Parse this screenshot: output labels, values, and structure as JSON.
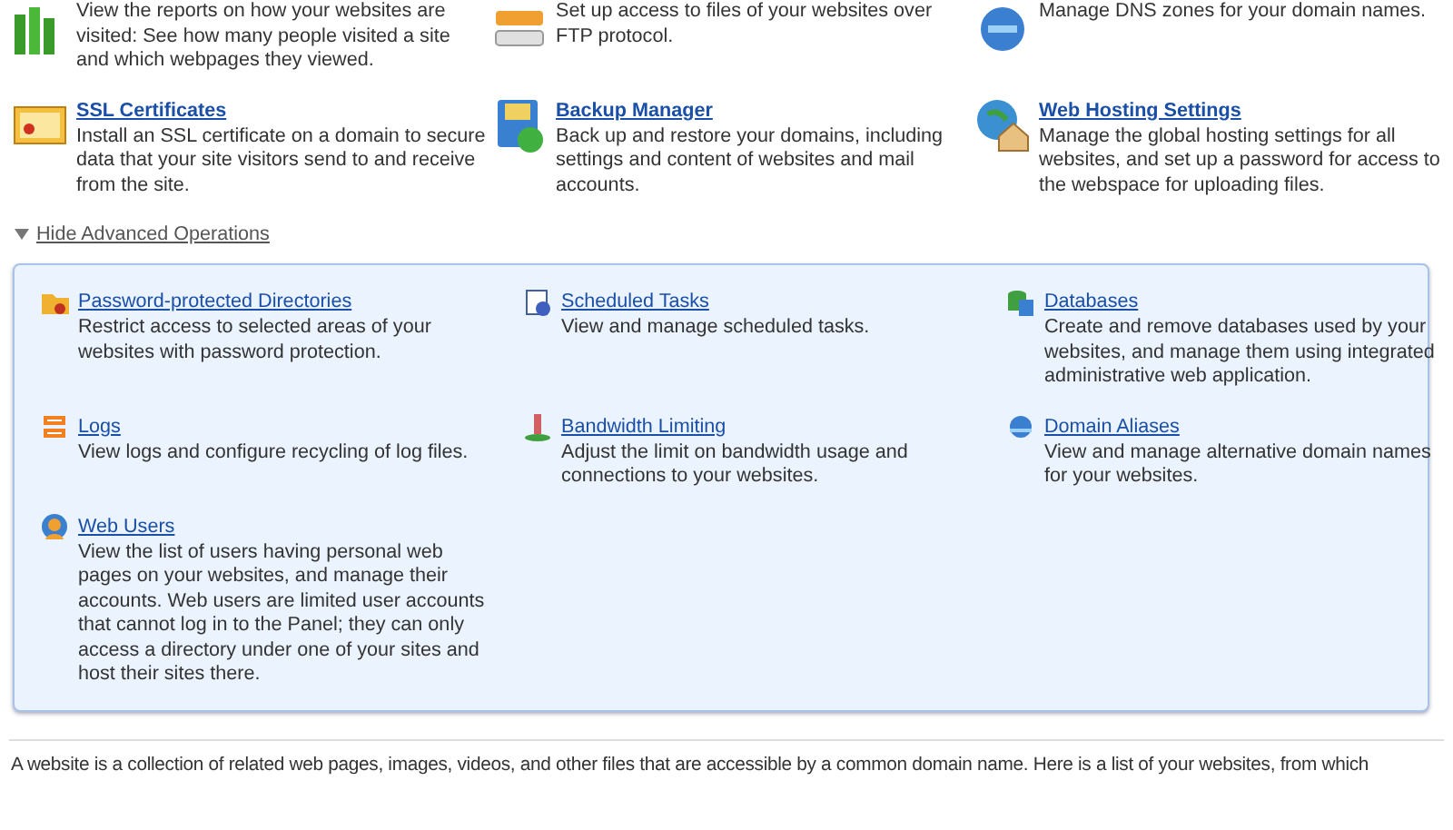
{
  "operations": [
    {
      "description": "View the reports on how your websites are visited: See how many people visited a site and which webpages they viewed."
    },
    {
      "description": "Set up access to files of your websites over FTP protocol."
    },
    {
      "description": "Manage DNS zones for your domain names."
    },
    {
      "title": "SSL Certificates",
      "description": "Install an SSL certificate on a domain to secure data that your site visitors send to and receive from the site."
    },
    {
      "title": "Backup Manager",
      "description": "Back up and restore your domains, including settings and content of websites and mail accounts."
    },
    {
      "title": "Web Hosting Settings",
      "description": "Manage the global hosting settings for all websites, and set up a password for access to the webspace for uploading files."
    }
  ],
  "advanced": {
    "toggle": "Hide Advanced Operations",
    "expanded": true,
    "items": [
      {
        "title": "Password-protected Directories",
        "description": "Restrict access to selected areas of your websites with password protection."
      },
      {
        "title": "Scheduled Tasks",
        "description": "View and manage scheduled tasks."
      },
      {
        "title": "Databases",
        "description": "Create and remove databases used by your websites, and manage them using integrated administrative web application."
      },
      {
        "title": "Logs",
        "description": "View logs and configure recycling of log files."
      },
      {
        "title": "Bandwidth Limiting",
        "description": "Adjust the limit on bandwidth usage and connections to your websites."
      },
      {
        "title": "Domain Aliases",
        "description": "View and manage alternative domain names for your websites."
      },
      {
        "title": "Web Users",
        "description": "View the list of users having personal web pages on your websites, and manage their accounts. Web users are limited user accounts that cannot log in to the Panel; they can only access a directory under one of your sites and host their sites there."
      }
    ]
  },
  "intro": "A website is a collection of related web pages, images, videos, and other files that are accessible by a common domain name. Here is a list of your websites, from which"
}
